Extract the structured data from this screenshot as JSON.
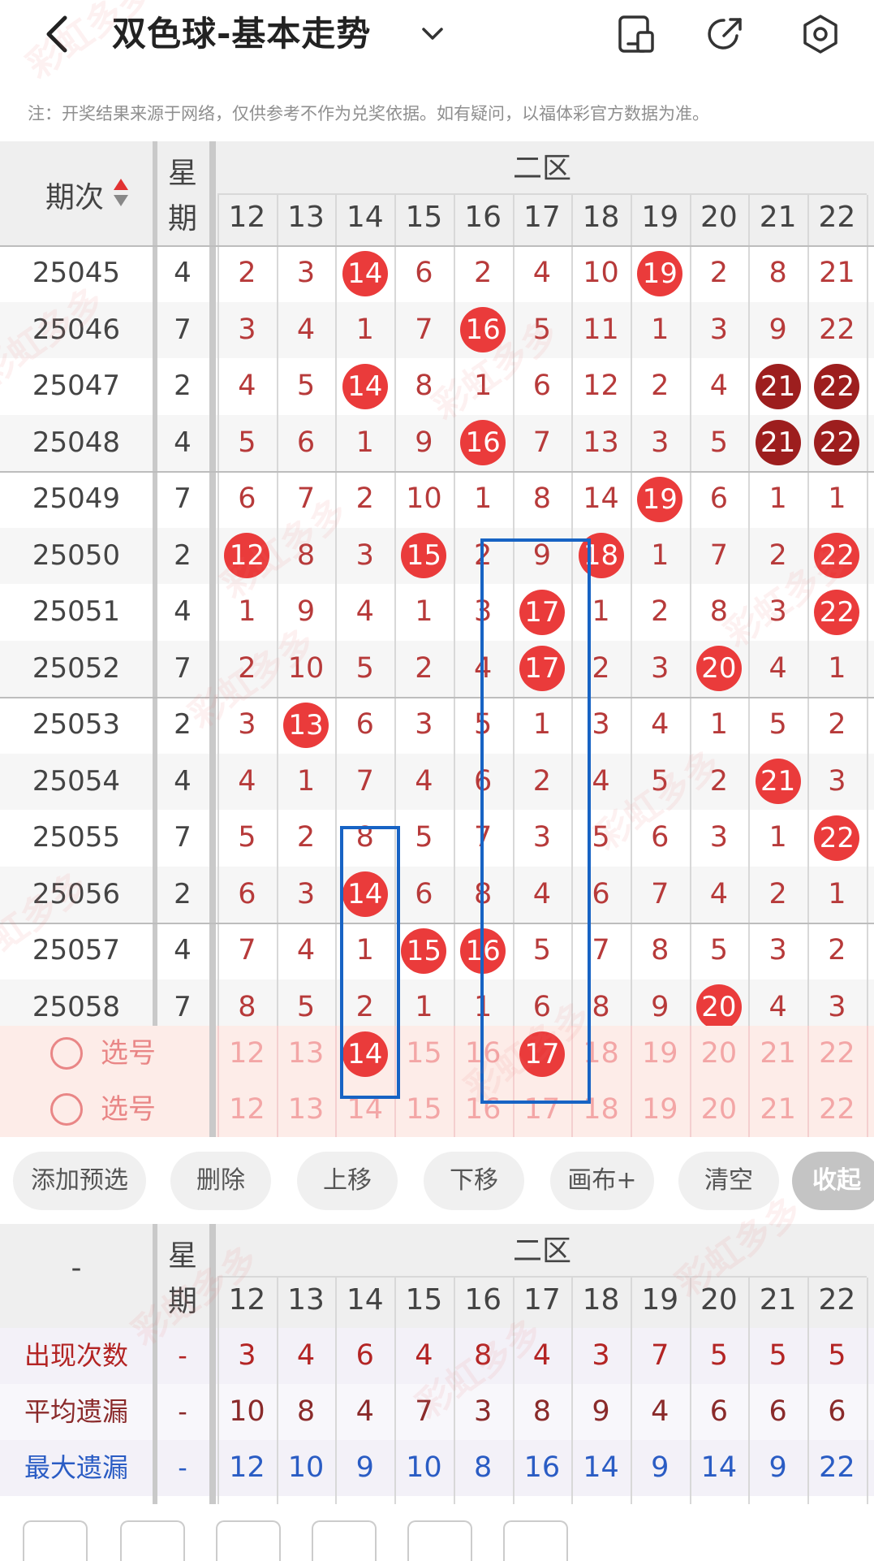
{
  "header": {
    "title": "双色球-基本走势"
  },
  "notice": "注：开奖结果来源于网络，仅供参考不作为兑奖依据。如有疑问，以福体彩官方数据为准。",
  "main_table": {
    "period_header": "期次",
    "week_header": [
      "星",
      "期"
    ],
    "zone_header": "二区",
    "columns": [
      "12",
      "13",
      "14",
      "15",
      "16",
      "17",
      "18",
      "19",
      "20",
      "21",
      "22"
    ],
    "rows": [
      {
        "period": "25045",
        "week": "4",
        "cells": [
          "2",
          "3",
          "14",
          "6",
          "2",
          "4",
          "10",
          "19",
          "2",
          "8",
          "21"
        ],
        "hits": [
          2,
          7
        ],
        "dark": []
      },
      {
        "period": "25046",
        "week": "7",
        "cells": [
          "3",
          "4",
          "1",
          "7",
          "16",
          "5",
          "11",
          "1",
          "3",
          "9",
          "22"
        ],
        "hits": [
          4
        ],
        "dark": []
      },
      {
        "period": "25047",
        "week": "2",
        "cells": [
          "4",
          "5",
          "14",
          "8",
          "1",
          "6",
          "12",
          "2",
          "4",
          "21",
          "22"
        ],
        "hits": [
          2
        ],
        "dark": [
          9,
          10
        ]
      },
      {
        "period": "25048",
        "week": "4",
        "cells": [
          "5",
          "6",
          "1",
          "9",
          "16",
          "7",
          "13",
          "3",
          "5",
          "21",
          "22"
        ],
        "hits": [
          4
        ],
        "dark": [
          9,
          10
        ]
      },
      {
        "period": "25049",
        "week": "7",
        "cells": [
          "6",
          "7",
          "2",
          "10",
          "1",
          "8",
          "14",
          "19",
          "6",
          "1",
          "1"
        ],
        "hits": [
          7
        ],
        "dark": []
      },
      {
        "period": "25050",
        "week": "2",
        "cells": [
          "12",
          "8",
          "3",
          "15",
          "2",
          "9",
          "18",
          "1",
          "7",
          "2",
          "22"
        ],
        "hits": [
          0,
          3,
          6,
          10
        ],
        "dark": []
      },
      {
        "period": "25051",
        "week": "4",
        "cells": [
          "1",
          "9",
          "4",
          "1",
          "3",
          "17",
          "1",
          "2",
          "8",
          "3",
          "22"
        ],
        "hits": [
          5,
          10
        ],
        "dark": []
      },
      {
        "period": "25052",
        "week": "7",
        "cells": [
          "2",
          "10",
          "5",
          "2",
          "4",
          "17",
          "2",
          "3",
          "20",
          "4",
          "1"
        ],
        "hits": [
          5,
          8
        ],
        "dark": []
      },
      {
        "period": "25053",
        "week": "2",
        "cells": [
          "3",
          "13",
          "6",
          "3",
          "5",
          "1",
          "3",
          "4",
          "1",
          "5",
          "2"
        ],
        "hits": [
          1
        ],
        "dark": []
      },
      {
        "period": "25054",
        "week": "4",
        "cells": [
          "4",
          "1",
          "7",
          "4",
          "6",
          "2",
          "4",
          "5",
          "2",
          "21",
          "3"
        ],
        "hits": [
          9
        ],
        "dark": []
      },
      {
        "period": "25055",
        "week": "7",
        "cells": [
          "5",
          "2",
          "8",
          "5",
          "7",
          "3",
          "5",
          "6",
          "3",
          "1",
          "22"
        ],
        "hits": [
          10
        ],
        "dark": []
      },
      {
        "period": "25056",
        "week": "2",
        "cells": [
          "6",
          "3",
          "14",
          "6",
          "8",
          "4",
          "6",
          "7",
          "4",
          "2",
          "1"
        ],
        "hits": [
          2
        ],
        "dark": []
      },
      {
        "period": "25057",
        "week": "4",
        "cells": [
          "7",
          "4",
          "1",
          "15",
          "16",
          "5",
          "7",
          "8",
          "5",
          "3",
          "2"
        ],
        "hits": [
          3,
          4
        ],
        "dark": []
      },
      {
        "period": "25058",
        "week": "7",
        "cells": [
          "8",
          "5",
          "2",
          "1",
          "1",
          "6",
          "8",
          "9",
          "20",
          "4",
          "3"
        ],
        "hits": [
          8
        ],
        "dark": []
      }
    ]
  },
  "picker": {
    "rows": [
      {
        "label": "选号",
        "cells": [
          "12",
          "13",
          "14",
          "15",
          "16",
          "17",
          "18",
          "19",
          "20",
          "21",
          "22"
        ],
        "selected": [
          2,
          5
        ]
      },
      {
        "label": "选号",
        "cells": [
          "12",
          "13",
          "14",
          "15",
          "16",
          "17",
          "18",
          "19",
          "20",
          "21",
          "22"
        ],
        "selected": []
      }
    ]
  },
  "toolbar": {
    "buttons": [
      "添加预选",
      "删除",
      "上移",
      "下移",
      "画布+",
      "清空",
      "收起"
    ]
  },
  "stats_table": {
    "corner": "-",
    "week_header": [
      "星",
      "期"
    ],
    "zone_header": "二区",
    "columns": [
      "12",
      "13",
      "14",
      "15",
      "16",
      "17",
      "18",
      "19",
      "20",
      "21",
      "22"
    ],
    "rows": [
      {
        "label": "出现次数",
        "week": "-",
        "cells": [
          "3",
          "4",
          "6",
          "4",
          "8",
          "4",
          "3",
          "7",
          "5",
          "5",
          "5"
        ],
        "color": "#b32424"
      },
      {
        "label": "平均遗漏",
        "week": "-",
        "cells": [
          "10",
          "8",
          "4",
          "7",
          "3",
          "8",
          "9",
          "4",
          "6",
          "6",
          "6"
        ],
        "color": "#8a2a2a"
      },
      {
        "label": "最大遗漏",
        "week": "-",
        "cells": [
          "12",
          "10",
          "9",
          "10",
          "8",
          "16",
          "14",
          "9",
          "14",
          "9",
          "22"
        ],
        "color": "#2a5cc4"
      }
    ]
  },
  "watermark": "彩虹多多",
  "colors": {
    "ball_red": "#ea3b3b",
    "ball_dark": "#9d1e1e",
    "selection_box": "#1763c4",
    "header_bg": "#efefef",
    "picker_bg": "#fdece8"
  }
}
